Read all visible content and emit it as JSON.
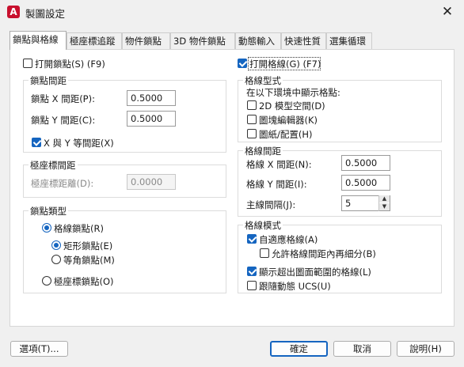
{
  "window": {
    "title": "製圖設定",
    "app_icon": "A",
    "close": "✕"
  },
  "tabs": [
    {
      "label": "鎖點與格線"
    },
    {
      "label": "極座標追蹤"
    },
    {
      "label": "物件鎖點"
    },
    {
      "label": "3D 物件鎖點"
    },
    {
      "label": "動態輸入"
    },
    {
      "label": "快速性質"
    },
    {
      "label": "選集循環"
    }
  ],
  "snap": {
    "enable_label": "打開鎖點(S) (F9)",
    "enable_checked": false,
    "spacing_title": "鎖點間距",
    "x_label": "鎖點 X 間距(P):",
    "x_value": "0.5000",
    "y_label": "鎖點 Y 間距(C):",
    "y_value": "0.5000",
    "equal_label": "X 與 Y 等間距(X)",
    "equal_checked": true,
    "polar_title": "極座標間距",
    "polar_label": "極座標距離(D):",
    "polar_value": "0.0000",
    "type_title": "鎖點類型",
    "grid_snap_label": "格線鎖點(R)",
    "rect_snap_label": "矩形鎖點(E)",
    "iso_snap_label": "等角鎖點(M)",
    "polar_snap_label": "極座標鎖點(O)"
  },
  "grid": {
    "enable_label": "打開格線(G) (F7)",
    "enable_checked": true,
    "style_title": "格線型式",
    "style_desc": "在以下環境中顯示格點:",
    "model_label": "2D 模型空間(D)",
    "block_label": "圖塊編輯器(K)",
    "sheet_label": "圖紙/配置(H)",
    "spacing_title": "格線間距",
    "x_label": "格線 X 間距(N):",
    "x_value": "0.5000",
    "y_label": "格線 Y 間距(I):",
    "y_value": "0.5000",
    "major_label": "主線間隔(J):",
    "major_value": "5",
    "behavior_title": "格線模式",
    "adaptive_label": "自適應格線(A)",
    "subdivide_label": "允許格線間距內再細分(B)",
    "beyond_label": "顯示超出圖面範圍的格線(L)",
    "follow_label": "跟隨動態 UCS(U)"
  },
  "buttons": {
    "options": "選項(T)...",
    "ok": "確定",
    "cancel": "取消",
    "help": "說明(H)"
  },
  "colors": {
    "accent": "#1565c0",
    "app_icon": "#c8102e"
  }
}
